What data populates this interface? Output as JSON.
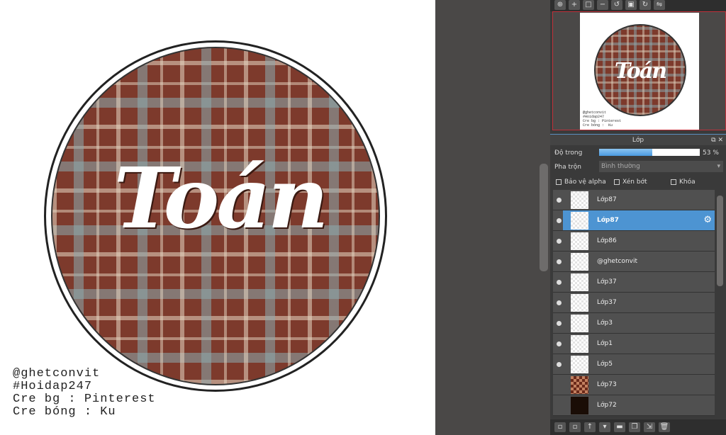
{
  "canvas": {
    "title_art": "Toán",
    "credits": [
      "@ghetconvit",
      "#Hoidap247",
      "Cre bg : Pinterest",
      "Cre bóng :  Ku"
    ]
  },
  "toolbar": {
    "icons": [
      "zoom-fit-icon",
      "zoom-in-icon",
      "fit-screen-icon",
      "zoom-out-icon",
      "rotate-left-icon",
      "reset-view-icon",
      "rotate-right-icon",
      "flip-icon"
    ]
  },
  "panel": {
    "title": "Lớp",
    "opacity_label": "Độ trong",
    "opacity_value": "53 %",
    "opacity_percent": 53,
    "blend_label": "Pha trộn",
    "blend_value": "Bình thường",
    "checkboxes": {
      "alpha": "Bảo vệ alpha",
      "clip": "Xén bớt",
      "lock": "Khóa"
    },
    "layers": [
      {
        "name": "Lớp87",
        "visible": true
      },
      {
        "name": "Lớp87",
        "visible": true,
        "selected": true
      },
      {
        "name": "Lớp86",
        "visible": true
      },
      {
        "name": "@ghetconvit",
        "visible": true
      },
      {
        "name": "Lớp37",
        "visible": true
      },
      {
        "name": "Lớp37",
        "visible": true
      },
      {
        "name": "Lớp3",
        "visible": true
      },
      {
        "name": "Lớp1",
        "visible": true
      },
      {
        "name": "Lớp5",
        "visible": true
      },
      {
        "name": "Lớp73",
        "visible": false
      },
      {
        "name": "Lớp72",
        "visible": false
      }
    ]
  },
  "colors": {
    "selection": "#4d94d2",
    "navigator_border": "#c0303a",
    "plaid_base": "#7d3a2c"
  }
}
